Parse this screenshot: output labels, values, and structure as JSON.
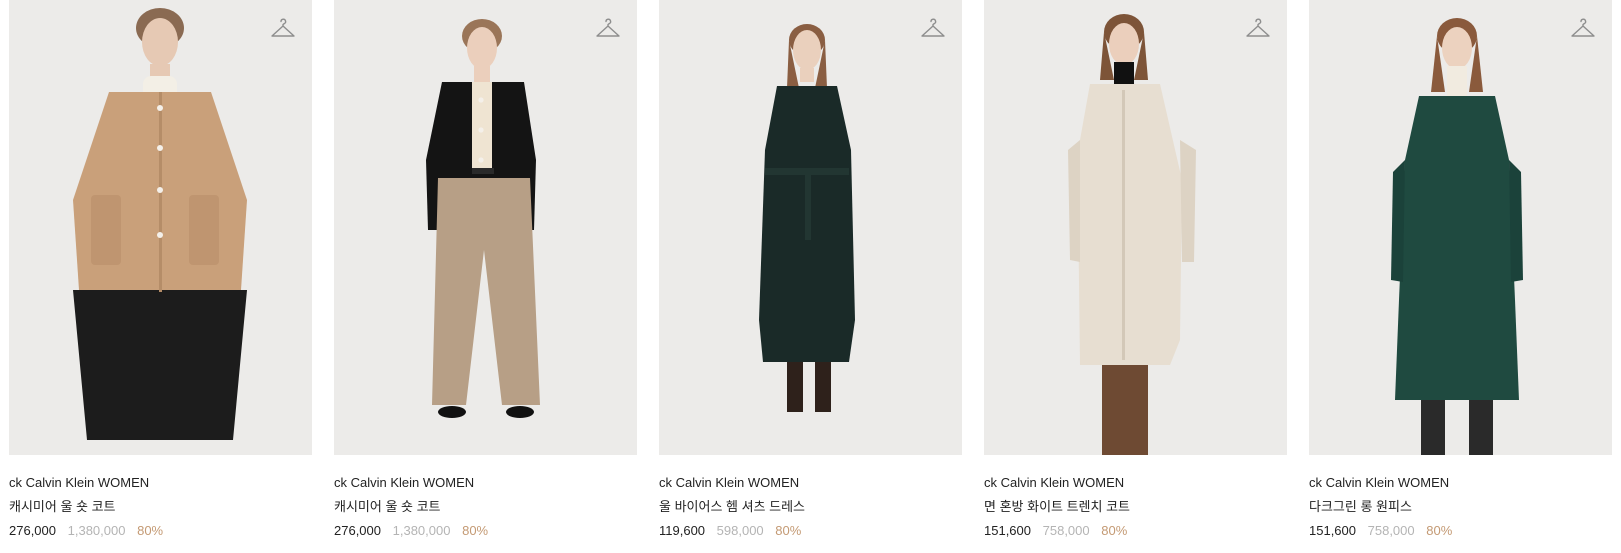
{
  "colors": {
    "discount": "#c49a74",
    "original_price": "#b4b4b4",
    "text": "#222222",
    "photo_bg": "#ecebe9"
  },
  "products": [
    {
      "brand": "ck Calvin Klein WOMEN",
      "title": "캐시미어 울 숏 코트",
      "sale_price": "276,000",
      "original_price": "1,380,000",
      "discount": "80%",
      "icon": "hanger-icon",
      "garment_color": "#c9a07a",
      "lower_color": "#1c1c1c"
    },
    {
      "brand": "ck Calvin Klein WOMEN",
      "title": "캐시미어 울 숏 코트",
      "sale_price": "276,000",
      "original_price": "1,380,000",
      "discount": "80%",
      "icon": "hanger-icon",
      "garment_color": "#141414",
      "lower_color": "#b79f86"
    },
    {
      "brand": "ck Calvin Klein WOMEN",
      "title": "울 바이어스 헴 셔츠 드레스",
      "sale_price": "119,600",
      "original_price": "598,000",
      "discount": "80%",
      "icon": "hanger-icon",
      "garment_color": "#1a2a28",
      "lower_color": "#3a2a22"
    },
    {
      "brand": "ck Calvin Klein WOMEN",
      "title": "면 혼방 화이트 트렌치 코트",
      "sale_price": "151,600",
      "original_price": "758,000",
      "discount": "80%",
      "icon": "hanger-icon",
      "garment_color": "#e7ded1",
      "lower_color": "#6e4a33"
    },
    {
      "brand": "ck Calvin Klein WOMEN",
      "title": "다크그린 롱 원피스",
      "sale_price": "151,600",
      "original_price": "758,000",
      "discount": "80%",
      "icon": "hanger-icon",
      "garment_color": "#1f4a40",
      "lower_color": "#2a2a2a"
    }
  ]
}
